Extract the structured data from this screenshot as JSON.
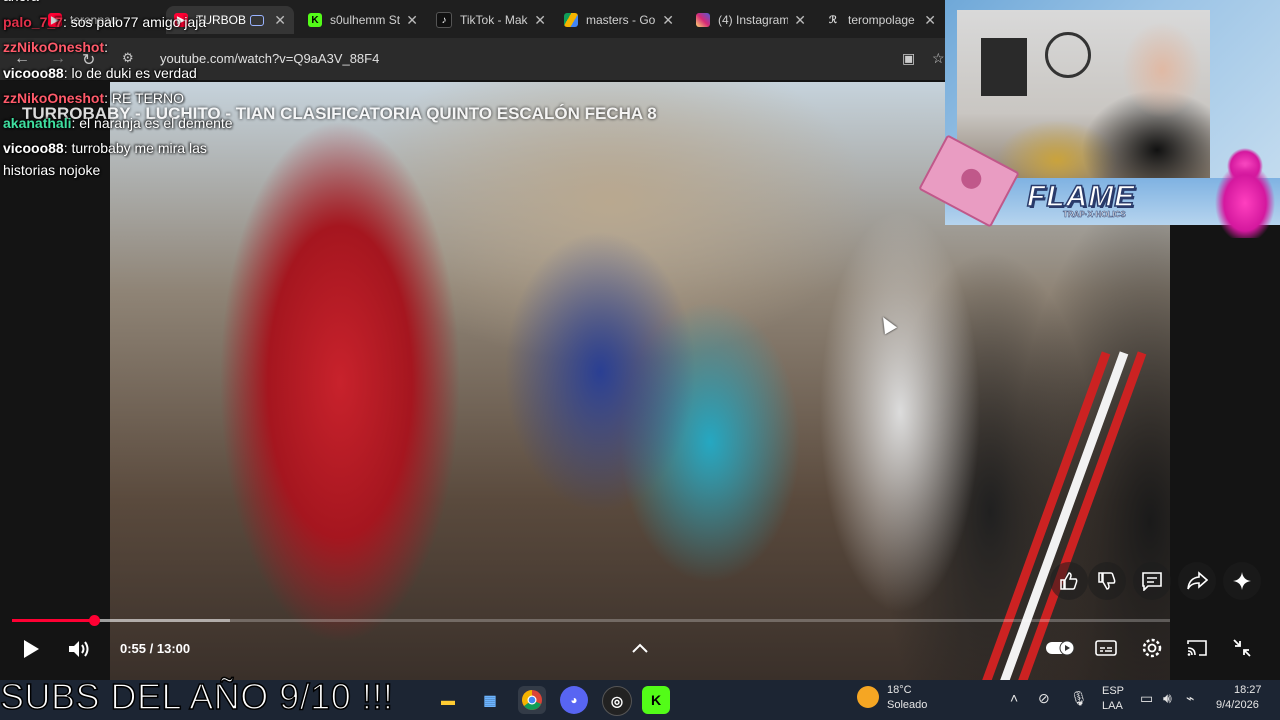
{
  "browser": {
    "tabs": [
      {
        "title": "teronpau",
        "icon": "youtube-icon",
        "color": "#ff0033"
      },
      {
        "title": "TURBOB",
        "icon": "youtube-icon",
        "color": "#ff0033"
      },
      {
        "title": "s0ulhemm St",
        "icon": "kick-icon",
        "color": "#53fc18"
      },
      {
        "title": "TikTok - Mak",
        "icon": "tiktok-icon",
        "color": "#ffffff"
      },
      {
        "title": "masters - Go",
        "icon": "google-drive-icon",
        "color": "#f4b400"
      },
      {
        "title": "(4) Instagram",
        "icon": "instagram-icon",
        "color": "#d62976"
      },
      {
        "title": "terompolage",
        "icon": "wordpress-icon",
        "color": "#dddddd"
      }
    ],
    "url": "youtube.com/watch?v=Q9aA3V_88F4"
  },
  "chat": {
    "messages": [
      {
        "user": "",
        "text": "ahora",
        "user_color": "#ffffff"
      },
      {
        "user": "palo_7_7",
        "text": ": sos palo77 amigo jaja",
        "user_color": "#e0304a"
      },
      {
        "user": "zzNikoOneshot",
        "text": ":",
        "user_color": "#ff5a6a"
      },
      {
        "user": "vicooo88",
        "text": ": lo de duki es verdad",
        "user_color": "#ffffff"
      },
      {
        "user": "zzNikoOneshot",
        "text": ": RE TERNO",
        "user_color": "#ff5a6a"
      },
      {
        "user": "akanathali",
        "text": ": el naranja es el demente",
        "user_color": "#3fe0a0"
      },
      {
        "user": "vicooo88",
        "text": ": turrobaby me mira las",
        "user_color": "#ffffff"
      },
      {
        "user": "",
        "text": "historias nojoke",
        "user_color": "#ffffff"
      }
    ]
  },
  "video": {
    "title": "TURROBABY - LUCHITO - TIAN CLASIFICATORIA QUINTO ESCALÓN FECHA 8",
    "time": "0:55 / 13:00",
    "progress": 0.071,
    "buffered": 0.188,
    "actions": [
      "like-icon",
      "dislike-icon",
      "comment-icon",
      "share-icon",
      "sparkle-icon"
    ]
  },
  "webcam": {
    "banner": "FLAME",
    "banner_sub": "TRAP·X·HOLICS"
  },
  "ticker": "SUBS DEL AÑO 9/10 !!!",
  "taskbar": {
    "weather_temp": "18°C",
    "weather_desc": "Soleado",
    "lang_top": "ESP",
    "lang_bottom": "LAA",
    "time": "18:27",
    "date": "9/4/2026"
  }
}
